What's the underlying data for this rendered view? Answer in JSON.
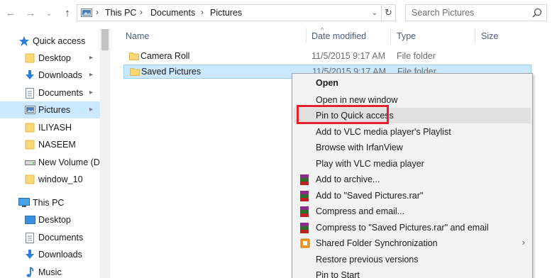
{
  "window": {
    "width": 785,
    "height": 392
  },
  "nav_buttons": {
    "back": "←",
    "forward": "→",
    "dropdown": "⌄",
    "up": "↑"
  },
  "address": {
    "breadcrumbs": [
      "This PC",
      "Documents",
      "Pictures"
    ],
    "separator": "›",
    "dropdown": "⌄",
    "refresh": "↻"
  },
  "search": {
    "placeholder": "Search Pictures"
  },
  "sidebar": {
    "items": [
      {
        "label": "Quick access",
        "icon": "star-icon",
        "pinned": false
      },
      {
        "label": "Desktop",
        "icon": "folder-icon",
        "pinned": true
      },
      {
        "label": "Downloads",
        "icon": "download-icon",
        "pinned": true
      },
      {
        "label": "Documents",
        "icon": "documents-icon",
        "pinned": true
      },
      {
        "label": "Pictures",
        "icon": "pictures-icon",
        "pinned": true,
        "selected": true
      },
      {
        "label": "ILIYASH",
        "icon": "folder-icon",
        "pinned": false
      },
      {
        "label": "NASEEM",
        "icon": "folder-icon",
        "pinned": false
      },
      {
        "label": "New Volume (D:",
        "icon": "drive-icon",
        "pinned": false
      },
      {
        "label": "window_10",
        "icon": "folder-icon",
        "pinned": false
      },
      {
        "label": "This PC",
        "icon": "computer-icon",
        "pinned": false
      },
      {
        "label": "Desktop",
        "icon": "desktop-icon",
        "pinned": false
      },
      {
        "label": "Documents",
        "icon": "documents-icon",
        "pinned": false
      },
      {
        "label": "Downloads",
        "icon": "download-icon",
        "pinned": false
      },
      {
        "label": "Music",
        "icon": "music-icon",
        "pinned": false
      }
    ],
    "pin_glyph": "📌"
  },
  "columns": {
    "name": "Name",
    "date": "Date modified",
    "type": "Type",
    "size": "Size",
    "sort_glyph": "^"
  },
  "files": [
    {
      "name": "Camera Roll",
      "date": "11/5/2015 9:17 AM",
      "type": "File folder"
    },
    {
      "name": "Saved Pictures",
      "date": "11/5/2015 9:17 AM",
      "type": "File folder",
      "selected": true
    }
  ],
  "context_menu": {
    "items": [
      {
        "label": "Open",
        "bold": true
      },
      {
        "label": "Open in new window"
      },
      {
        "label": "Pin to Quick access",
        "highlighted": true
      },
      {
        "label": "Add to VLC media player's Playlist"
      },
      {
        "label": "Browse with IrfanView"
      },
      {
        "label": "Play with VLC media player"
      },
      {
        "label": "Add to archive...",
        "icon": "winrar-icon"
      },
      {
        "label": "Add to \"Saved Pictures.rar\"",
        "icon": "winrar-icon"
      },
      {
        "label": "Compress and email...",
        "icon": "winrar-icon"
      },
      {
        "label": "Compress to \"Saved Pictures.rar\" and email",
        "icon": "winrar-icon"
      },
      {
        "label": "Shared Folder Synchronization",
        "icon": "sync-icon",
        "submenu": true,
        "arrow": "›"
      },
      {
        "label": "Restore previous versions"
      },
      {
        "label": "Pin to Start"
      }
    ]
  },
  "colors": {
    "selection": "#cce8ff",
    "highlight_box": "#e8202a",
    "menu_bg": "#f2f2f2",
    "header_text": "#4c607a"
  }
}
